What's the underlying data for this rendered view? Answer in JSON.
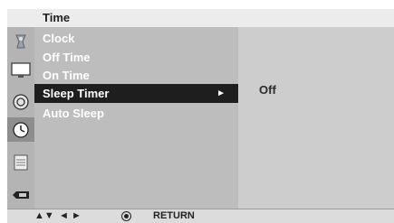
{
  "header": {
    "title": "Time"
  },
  "menu": {
    "items": [
      {
        "label": "Clock"
      },
      {
        "label": "Off Time"
      },
      {
        "label": "On Time"
      },
      {
        "label": "Sleep Timer",
        "arrow": "►"
      },
      {
        "label": "Auto Sleep"
      }
    ],
    "selected_index": 3
  },
  "value_panel": {
    "value": "Off"
  },
  "side_icons": [
    "picture-icon",
    "tv-icon",
    "audio-icon",
    "clock-icon",
    "settings-icon",
    "input-icon"
  ],
  "footer": {
    "nav_updown": "▲▼",
    "nav_leftright": "◄ ►",
    "return_label": "RETURN"
  }
}
